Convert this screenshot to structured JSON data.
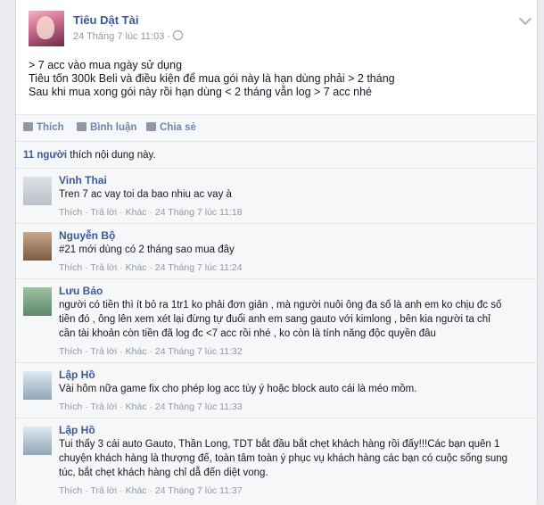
{
  "post": {
    "author": "Tiêu Dật Tài",
    "timestamp": "24 Tháng 7 lúc 11:03 · ",
    "privacy_icon": "globe-icon",
    "lines": [
      "> 7 acc vào mua ngày sử dụng",
      "Tiêu tốn 300k Beli và điều kiện để mua gói này là hạn dùng phải > 2 tháng",
      "Sau khi mua xong gói này rồi hạn dùng < 2 tháng vẫn log > 7 acc nhé"
    ]
  },
  "actions": {
    "like": "Thích",
    "comment": "Bình luận",
    "share": "Chia sẻ"
  },
  "likes": {
    "count": "11 người",
    "text": " thích nội dung này."
  },
  "comment_actions": {
    "like": "Thích",
    "reply": "Trả lời",
    "more": "Khác",
    "sep": " · "
  },
  "comments": [
    {
      "name": "Vinh Thai",
      "lines": [
        "Tren 7 ac vay toi da bao nhiu ac vay à"
      ],
      "time": "24 Tháng 7 lúc 11:18"
    },
    {
      "name": "Nguyễn Bộ",
      "lines": [
        "#21 mới dùng có 2 tháng sao mua đây"
      ],
      "time": "24 Tháng 7 lúc 11:24"
    },
    {
      "name": "Lưu Bảo",
      "lines": [
        "người có tiền thì ít bỏ ra 1tr1 ko phải đơn giản , mà người nuôi ông đa số là anh em ko chịu đc số",
        "tiền đó , ông lên xem xét lại đừng tự đuổi anh em sang gauto với kimlong , bên kia người ta chỉ",
        "cần tài khoản còn tiền đã log đc <7 acc rồi nhé , ko còn là tính năng độc quyền đâu"
      ],
      "time": "24 Tháng 7 lúc 11:32"
    },
    {
      "name": "Lập Hồ",
      "lines": [
        "Vài hôm nữa game fix cho phép log acc tùy ý hoặc block auto cái là méo mồm."
      ],
      "time": "24 Tháng 7 lúc 11:33"
    },
    {
      "name": "Lập Hồ",
      "lines": [
        "Tui thấy 3 cái auto Gauto, Thần Long, TDT bắt đầu bắt chẹt khách hàng rồi đấy!!!Các bạn quên 1",
        "chuyện khách hàng là thượng đế, toàn tâm toàn ý phục vụ khách hàng các bạn có cuộc sống sung",
        "túc, bắt chẹt khách hàng chỉ dẫ đến diệt vong."
      ],
      "time": "24 Tháng 7 lúc 11:37"
    }
  ]
}
